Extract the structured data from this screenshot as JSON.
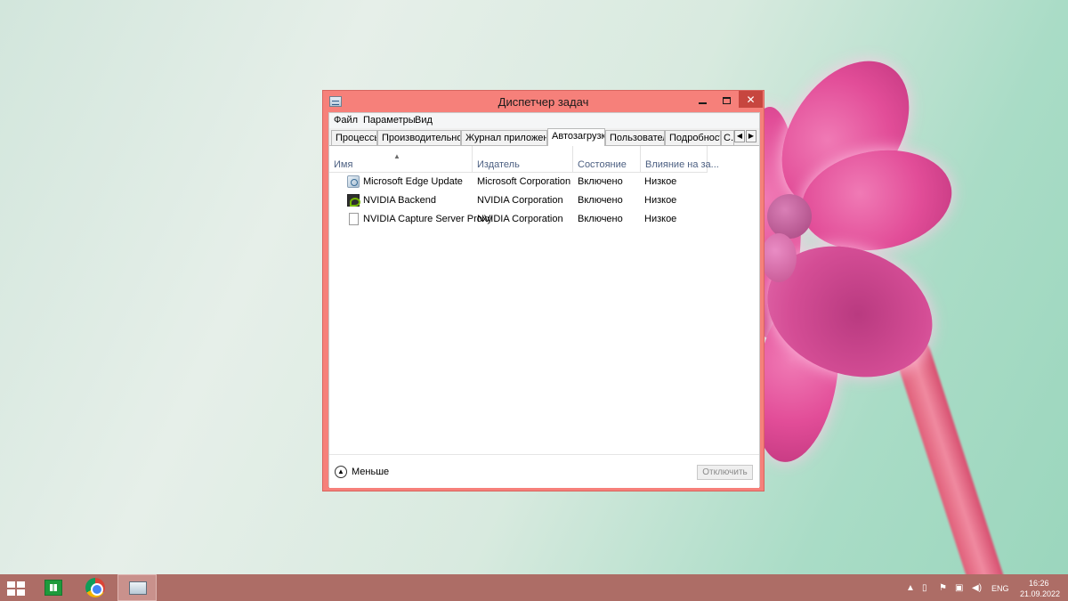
{
  "window": {
    "title": "Диспетчер задач"
  },
  "menu": [
    "Файл",
    "Параметры",
    "Вид"
  ],
  "tabs": [
    {
      "label": "Процессы"
    },
    {
      "label": "Производительность"
    },
    {
      "label": "Журнал приложений"
    },
    {
      "label": "Автозагрузка",
      "active": true
    },
    {
      "label": "Пользователи"
    },
    {
      "label": "Подробности"
    },
    {
      "label": "С..."
    }
  ],
  "table": {
    "columns": [
      "Имя",
      "Издатель",
      "Состояние",
      "Влияние на за..."
    ],
    "rows": [
      {
        "name": "Microsoft Edge Update",
        "publisher": "Microsoft Corporation",
        "status": "Включено",
        "impact": "Низкое",
        "icon": "edge-update-icon"
      },
      {
        "name": "NVIDIA Backend",
        "publisher": "NVIDIA Corporation",
        "status": "Включено",
        "impact": "Низкое",
        "icon": "nvidia-icon"
      },
      {
        "name": "NVIDIA Capture Server Proxy",
        "publisher": "NVIDIA Corporation",
        "status": "Включено",
        "impact": "Низкое",
        "icon": "file-icon"
      }
    ]
  },
  "footer": {
    "less_label": "Меньше",
    "disable_label": "Отключить"
  },
  "taskbar": {
    "apps": [
      "start-icon",
      "store-icon",
      "chrome-icon",
      "task-manager-icon"
    ],
    "language": "ENG",
    "time": "16:26",
    "date": "21.09.2022"
  },
  "colors": {
    "window_frame": "#f6807a",
    "close_button": "#c7463f",
    "taskbar": "#ad6d66"
  }
}
